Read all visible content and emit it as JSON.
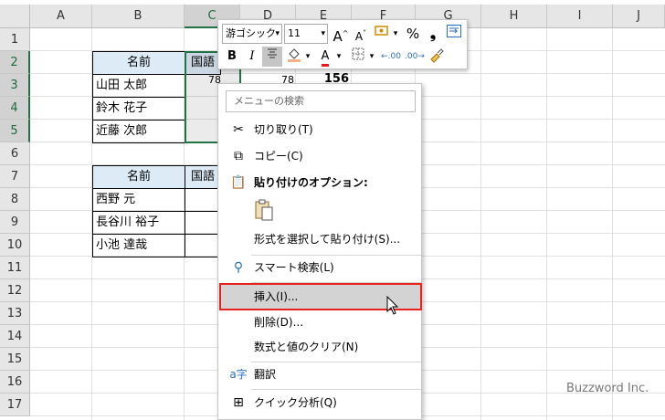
{
  "columns": [
    "A",
    "B",
    "C",
    "D",
    "E",
    "F",
    "G",
    "H",
    "I",
    "J"
  ],
  "rows": [
    "1",
    "2",
    "3",
    "4",
    "5",
    "6",
    "7",
    "8",
    "9",
    "10",
    "11",
    "12",
    "13",
    "14",
    "15",
    "16",
    "17"
  ],
  "table1": {
    "header_name": "名前",
    "header_col2": "国語",
    "names": [
      "山田 太郎",
      "鈴木 花子",
      "近藤 次郎"
    ],
    "c3_value": "78",
    "d3_value": "78",
    "e3_value": "156"
  },
  "table2": {
    "header_name": "名前",
    "header_col2": "国語",
    "names": [
      "西野 元",
      "長谷川 裕子",
      "小池 達哉"
    ]
  },
  "mini_toolbar": {
    "font_name": "游ゴシック",
    "font_size": "11",
    "grow_font": "A",
    "shrink_font": "A",
    "percent": "%",
    "comma": "❟",
    "bold": "B",
    "italic": "I",
    "font_color_letter": "A",
    "decimal_inc": "←.00",
    "decimal_dec": ".00→"
  },
  "context_menu": {
    "search_placeholder": "メニューの検索",
    "cut": "切り取り(T)",
    "copy": "コピー(C)",
    "paste_options": "貼り付けのオプション:",
    "paste_special": "形式を選択して貼り付け(S)...",
    "smart_lookup": "スマート検索(L)",
    "insert": "挿入(I)...",
    "delete": "削除(D)...",
    "clear_contents": "数式と値のクリア(N)",
    "translate": "翻訳",
    "quick_analysis": "クイック分析(Q)"
  },
  "watermark": "Buzzword Inc."
}
